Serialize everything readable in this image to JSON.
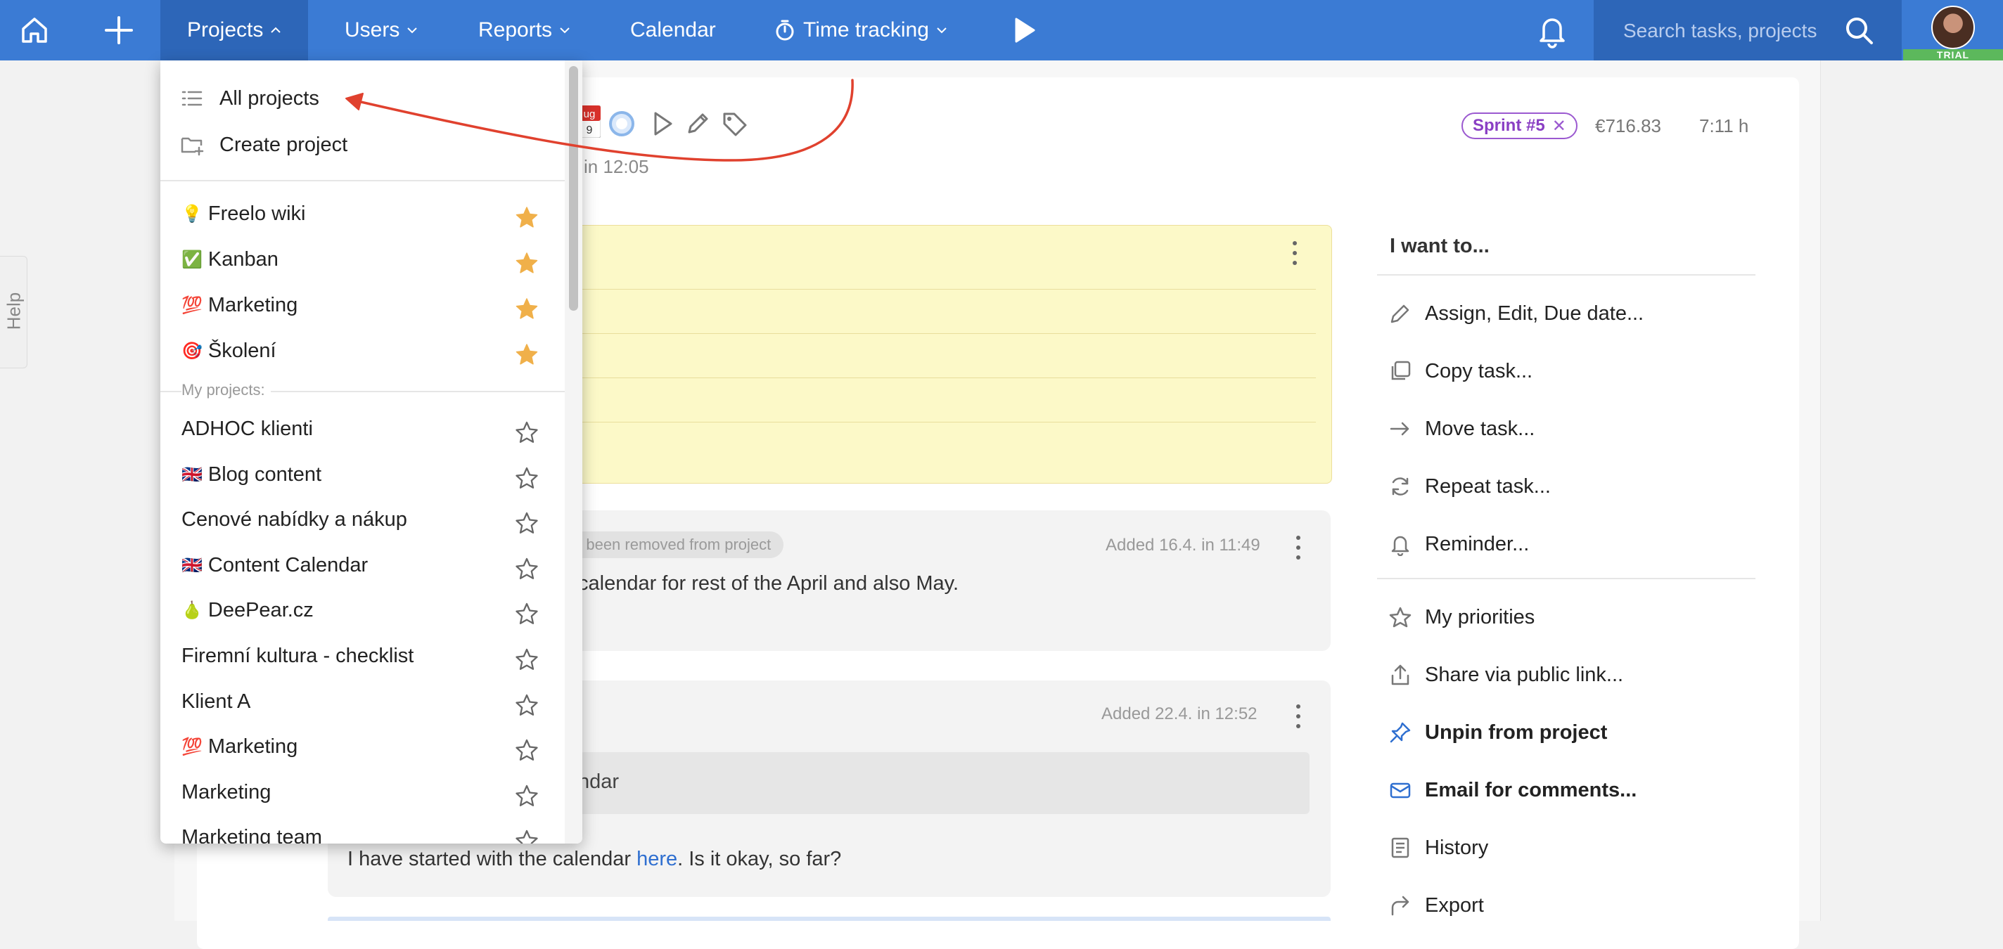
{
  "topnav": {
    "items": [
      {
        "label": "Projects"
      },
      {
        "label": "Users"
      },
      {
        "label": "Reports"
      },
      {
        "label": "Calendar"
      },
      {
        "label": "Time tracking"
      }
    ],
    "search_placeholder": "Search tasks, projects",
    "trial_label": "TRIAL",
    "accent_color": "#3b7bd4"
  },
  "help": {
    "label": "Help"
  },
  "task": {
    "date_badge_top": "ug",
    "date_badge_day": "9",
    "meta": "in 12:05",
    "sprint_label": "Sprint #5",
    "price": "€716.83",
    "time": "7:11 h"
  },
  "comments": [
    {
      "removed_pill": "as been removed from project",
      "added": "Added 16.4. in 11:49",
      "text": "calendar for rest of the April and also May."
    },
    {
      "added": "Added 22.4. in 12:52",
      "quote": "ndar",
      "text_before": "I have started with the calendar ",
      "link": "here",
      "text_after": ". Is it okay, so far?"
    }
  ],
  "actions": {
    "heading": "I want to...",
    "items": [
      {
        "label": "Assign, Edit, Due date...",
        "icon": "pencil-icon"
      },
      {
        "label": "Copy task...",
        "icon": "copy-icon"
      },
      {
        "label": "Move task...",
        "icon": "arrow-right-icon"
      },
      {
        "label": "Repeat task...",
        "icon": "repeat-icon"
      },
      {
        "label": "Reminder...",
        "icon": "bell-icon"
      },
      {
        "label": "My priorities",
        "icon": "star-icon"
      },
      {
        "label": "Share via public link...",
        "icon": "share-icon"
      },
      {
        "label": "Unpin from project",
        "icon": "pin-icon"
      },
      {
        "label": "Email for comments...",
        "icon": "email-icon"
      },
      {
        "label": "History",
        "icon": "history-icon"
      },
      {
        "label": "Export",
        "icon": "export-icon"
      }
    ]
  },
  "projects_menu": {
    "all_projects": "All projects",
    "create_project": "Create project",
    "favorites": [
      {
        "emoji": "💡",
        "label": "Freelo wiki",
        "starred": true
      },
      {
        "emoji": "✅",
        "label": "Kanban",
        "starred": true
      },
      {
        "emoji": "💯",
        "label": "Marketing",
        "starred": true
      },
      {
        "emoji": "🎯",
        "label": "Školení",
        "starred": true
      }
    ],
    "my_projects_label": "My projects:",
    "my_projects": [
      {
        "emoji": "",
        "label": "ADHOC klienti",
        "starred": false
      },
      {
        "emoji": "🇬🇧",
        "label": "Blog content",
        "starred": false
      },
      {
        "emoji": "",
        "label": "Cenové nabídky a nákup",
        "starred": false
      },
      {
        "emoji": "🇬🇧",
        "label": "Content Calendar",
        "starred": false
      },
      {
        "emoji": "🍐",
        "label": "DeePear.cz",
        "starred": false
      },
      {
        "emoji": "",
        "label": "Firemní kultura - checklist",
        "starred": false
      },
      {
        "emoji": "",
        "label": "Klient A",
        "starred": false
      },
      {
        "emoji": "💯",
        "label": "Marketing",
        "starred": false
      },
      {
        "emoji": "",
        "label": "Marketing",
        "starred": false
      },
      {
        "emoji": "",
        "label": "Marketing team",
        "starred": false
      }
    ]
  }
}
